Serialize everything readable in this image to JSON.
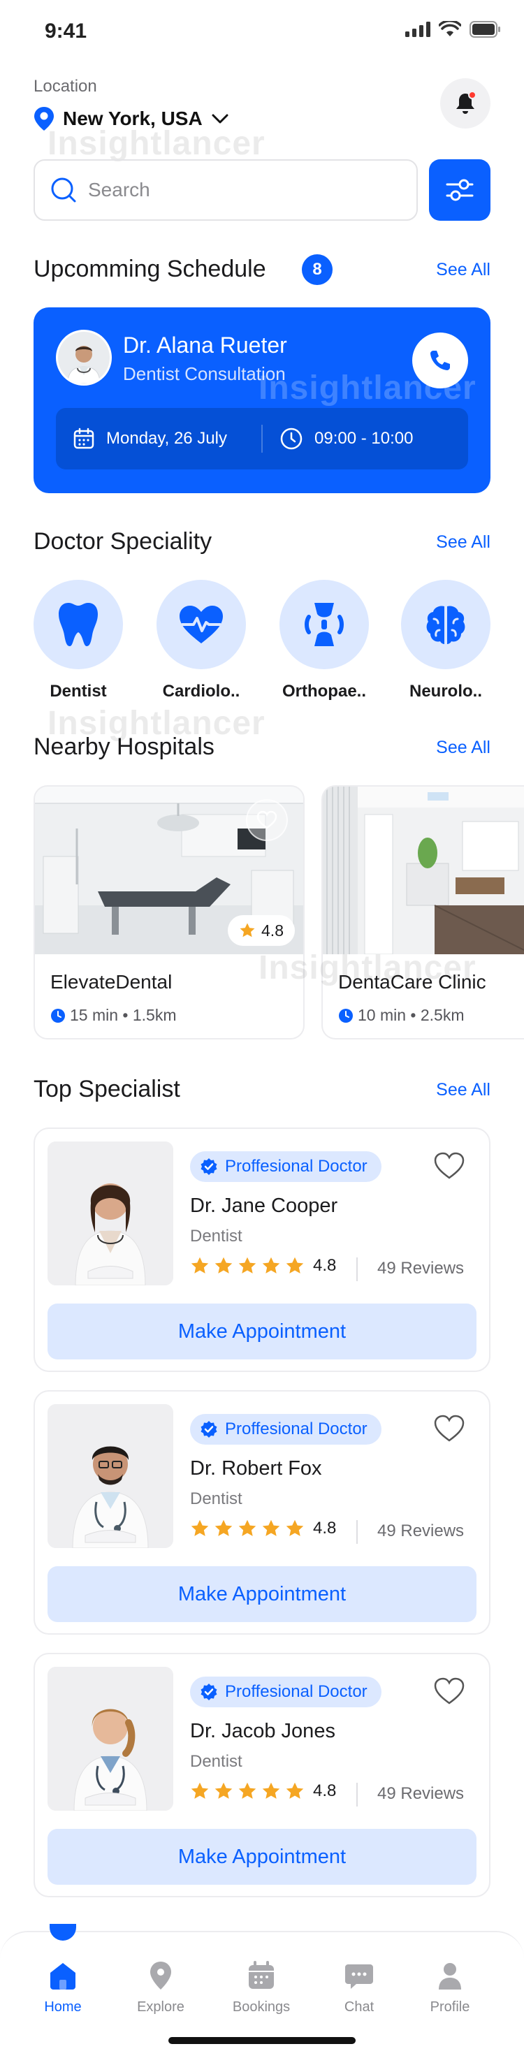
{
  "status": {
    "time": "9:41"
  },
  "location": {
    "label": "Location",
    "value": "New York, USA"
  },
  "watermark": "Insightlancer",
  "search": {
    "placeholder": "Search"
  },
  "schedule": {
    "title": "Upcomming Schedule",
    "count": "8",
    "see_all": "See All",
    "doctor": "Dr. Alana Rueter",
    "subtitle": "Dentist Consultation",
    "date": "Monday, 26 July",
    "time": "09:00 - 10:00"
  },
  "speciality": {
    "title": "Doctor Speciality",
    "see_all": "See All",
    "items": [
      {
        "label": "Dentist",
        "icon": "tooth-icon"
      },
      {
        "label": "Cardiolo..",
        "icon": "heart-pulse-icon"
      },
      {
        "label": "Orthopae..",
        "icon": "bone-joint-icon"
      },
      {
        "label": "Neurolo..",
        "icon": "brain-icon"
      }
    ]
  },
  "hospitals": {
    "title": "Nearby Hospitals",
    "see_all": "See All",
    "items": [
      {
        "name": "ElevateDental",
        "meta": "15 min • 1.5km",
        "rating": "4.8"
      },
      {
        "name": "DentaCare Clinic",
        "meta": "10 min • 2.5km",
        "rating": ""
      }
    ]
  },
  "specialists": {
    "title": "Top Specialist",
    "see_all": "See All",
    "items": [
      {
        "badge": "Proffesional Doctor",
        "name": "Dr. Jane Cooper",
        "role": "Dentist",
        "rating": "4.8",
        "reviews": "49 Reviews",
        "action": "Make Appointment"
      },
      {
        "badge": "Proffesional Doctor",
        "name": "Dr. Robert Fox",
        "role": "Dentist",
        "rating": "4.8",
        "reviews": "49 Reviews",
        "action": "Make Appointment"
      },
      {
        "badge": "Proffesional Doctor",
        "name": "Dr. Jacob Jones",
        "role": "Dentist",
        "rating": "4.8",
        "reviews": "49 Reviews",
        "action": "Make Appointment"
      }
    ]
  },
  "nav": {
    "items": [
      {
        "label": "Home",
        "icon": "home-icon",
        "active": true
      },
      {
        "label": "Explore",
        "icon": "map-pin-icon",
        "active": false
      },
      {
        "label": "Bookings",
        "icon": "calendar-icon",
        "active": false
      },
      {
        "label": "Chat",
        "icon": "chat-icon",
        "active": false
      },
      {
        "label": "Profile",
        "icon": "user-icon",
        "active": false
      }
    ]
  },
  "colors": {
    "primary": "#0a60ff",
    "primary_light": "#dce8ff",
    "star": "#f5a623",
    "notification": "#ff3b30"
  }
}
